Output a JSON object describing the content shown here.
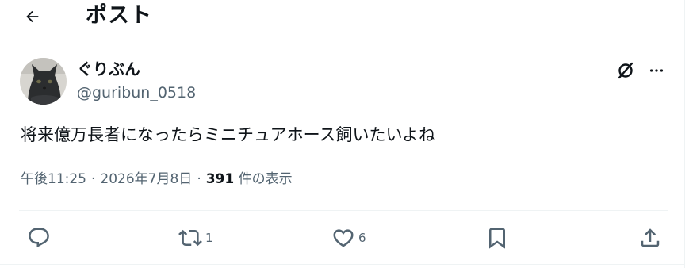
{
  "header": {
    "title": "ポスト"
  },
  "author": {
    "display_name": "ぐりぶん",
    "handle": "@guribun_0518"
  },
  "post": {
    "text": "将来億万長者になったらミニチュアホース飼いたいよね"
  },
  "meta": {
    "time": "午後11:25",
    "date": "2026年7月8日",
    "separator": "·",
    "views_count": "391",
    "views_label": "件の表示"
  },
  "actions": {
    "reply_count": "",
    "repost_count": "1",
    "like_count": "6"
  },
  "icons": [
    "back-arrow-icon",
    "grok-icon",
    "more-icon",
    "reply-icon",
    "repost-icon",
    "like-icon",
    "bookmark-icon",
    "share-icon"
  ]
}
